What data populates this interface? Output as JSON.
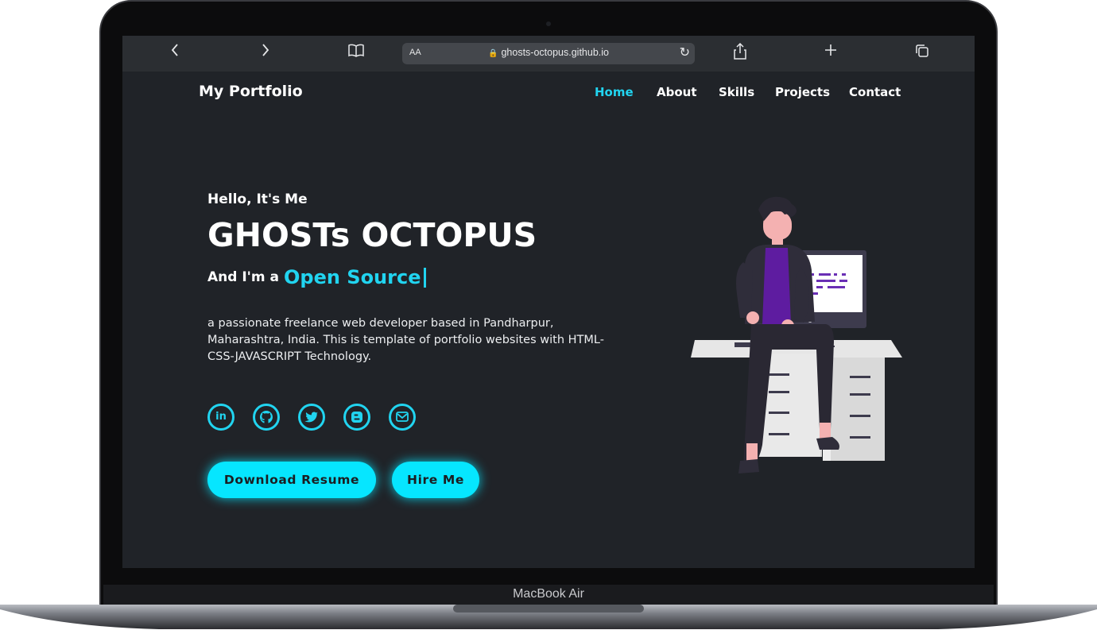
{
  "device": {
    "model_label": "MacBook Air"
  },
  "browser": {
    "text_size_label": "AA",
    "url": "ghosts-octopus.github.io",
    "icons": [
      "back-icon",
      "forward-icon",
      "bookmarks-icon",
      "lock-icon",
      "reload-icon",
      "share-icon",
      "new-tab-icon",
      "tabs-icon"
    ]
  },
  "site": {
    "logo": "My Portfolio",
    "nav": [
      "Home",
      "About",
      "Skills",
      "Projects",
      "Contact"
    ],
    "active_nav": "Home"
  },
  "hero": {
    "greeting": "Hello, It's Me",
    "name": "GHOSTs OCTOPUS",
    "role_prefix": "And I'm a",
    "role_typed": "Open Source",
    "description": "a passionate freelance web developer based in Pandharpur, Maharashtra, India. This is template of portfolio websites with HTML-CSS-JAVASCRIPT Technology.",
    "socials": [
      "linkedin-icon",
      "github-icon",
      "twitter-icon",
      "blogger-icon",
      "email-icon"
    ],
    "buttons": {
      "download": "Download Resume",
      "hire": "Hire Me"
    }
  },
  "colors": {
    "accent": "#21d4f0",
    "button": "#06e6ff",
    "page_bg": "#202328",
    "bezel": "#0c0c0d"
  }
}
